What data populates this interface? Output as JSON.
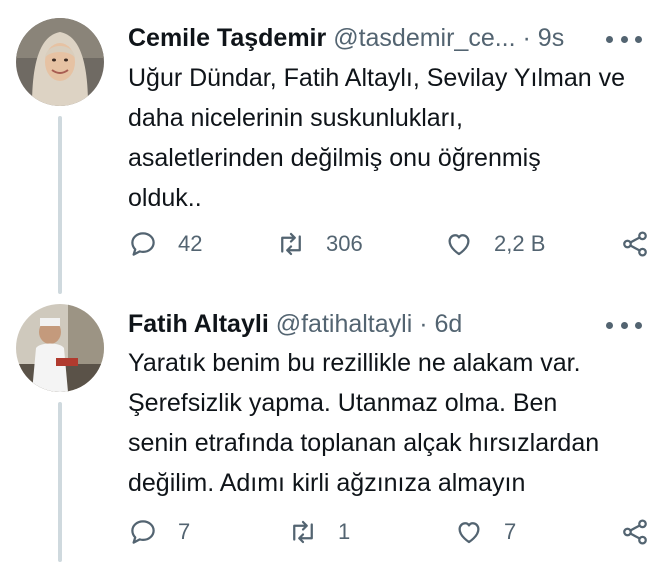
{
  "tweets": [
    {
      "name": "Cemile Taşdemir",
      "handle": "@tasdemir_ce...",
      "time": "9s",
      "lines": [
        "Uğur Dündar, Fatih Altaylı, Sevilay Yılman ve",
        "daha nicelerinin suskunlukları,",
        "asaletlerinden değilmiş onu öğrenmiş",
        "olduk.."
      ],
      "replies": "42",
      "retweets": "306",
      "likes": "2,2 B"
    },
    {
      "name": "Fatih Altayli",
      "handle": "@fatihaltayli",
      "time": "6d",
      "lines": [
        "Yaratık benim bu rezillikle ne alakam var.",
        "Şerefsizlik yapma. Utanmaz olma. Ben",
        "senin etrafında toplanan alçak hırsızlardan",
        "değilim. Adımı kirli ağzınıza almayın"
      ],
      "replies": "7",
      "retweets": "1",
      "likes": "7"
    }
  ],
  "separator": " · ",
  "icons": {
    "reply": "reply-icon",
    "retweet": "retweet-icon",
    "like": "heart-icon",
    "share": "share-icon",
    "more": "more-icon"
  },
  "colors": {
    "text": "#0f1419",
    "secondary": "#536471",
    "thread_line": "#cfd9de"
  }
}
